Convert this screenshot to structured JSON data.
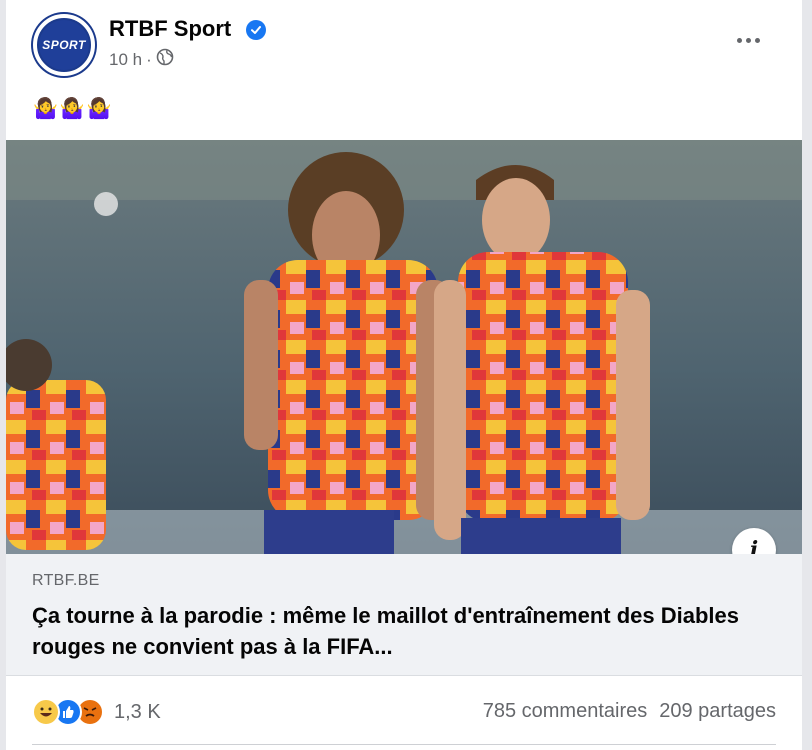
{
  "post": {
    "page_name": "RTBF Sport",
    "avatar_text": "SPORT",
    "timestamp": "10 h",
    "separator": "·",
    "privacy_icon": "globe-icon",
    "verified_icon": "verified-check-icon",
    "more_icon": "more-dots-icon",
    "text": "🤷‍♀️🤷‍♀️🤷‍♀️"
  },
  "link_preview": {
    "domain": "RTBF.BE",
    "title": "Ça tourne à la parodie : même le maillot d'entraînement des Diables rouges ne convient pas à la FIFA...",
    "info_icon": "i"
  },
  "engagement": {
    "reaction_icons": [
      "haha-reaction-icon",
      "like-reaction-icon",
      "angry-reaction-icon"
    ],
    "reaction_count": "1,3 K",
    "comments": "785 commentaires",
    "shares": "209 partages"
  },
  "colors": {
    "brand_blue": "#1b3a8c",
    "verified_blue": "#1877f2",
    "link_box_bg": "#f0f2f5"
  }
}
